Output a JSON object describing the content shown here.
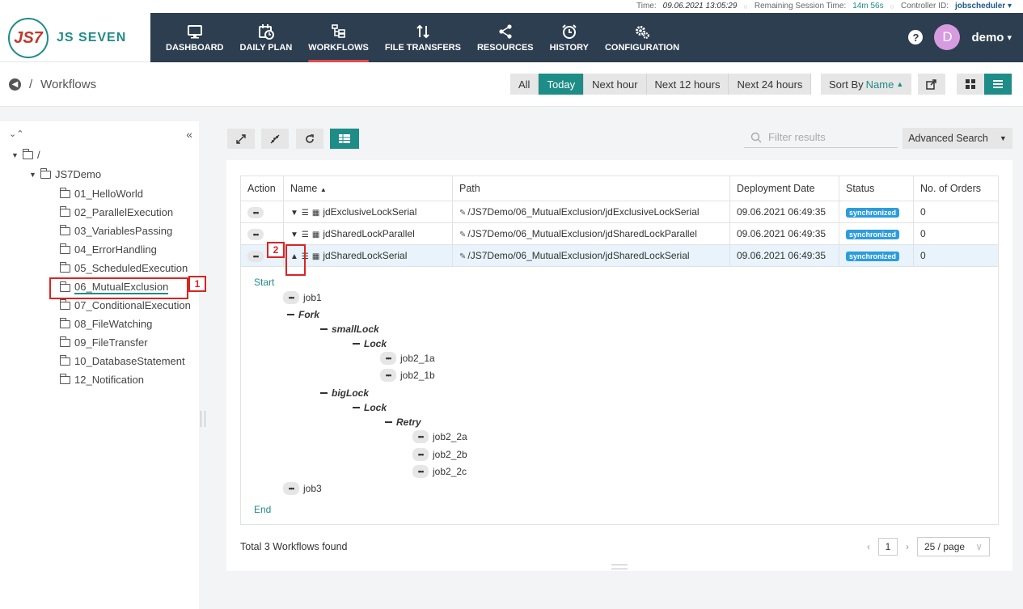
{
  "status_bar": {
    "time_label": "Time:",
    "time_value": "09.06.2021 13:05:29",
    "session_label": "Remaining Session Time:",
    "session_value": "14m 56s",
    "controller_label": "Controller ID:",
    "controller_value": "jobscheduler"
  },
  "brand": {
    "logo_mark": "JS7",
    "logo_text": "JS SEVEN"
  },
  "nav": [
    {
      "label": "DASHBOARD",
      "icon": "monitor-icon"
    },
    {
      "label": "DAILY PLAN",
      "icon": "calendar-icon"
    },
    {
      "label": "WORKFLOWS",
      "icon": "workflow-icon",
      "active": true
    },
    {
      "label": "FILE TRANSFERS",
      "icon": "transfer-icon"
    },
    {
      "label": "RESOURCES",
      "icon": "share-icon"
    },
    {
      "label": "HISTORY",
      "icon": "clock-icon"
    },
    {
      "label": "CONFIGURATION",
      "icon": "gears-icon"
    }
  ],
  "user": {
    "initial": "D",
    "name": "demo"
  },
  "breadcrumb": {
    "separator": "/",
    "title": "Workflows"
  },
  "filters": [
    "All",
    "Today",
    "Next hour",
    "Next 12 hours",
    "Next 24 hours"
  ],
  "active_filter": "Today",
  "sort": {
    "label": "Sort By",
    "value": "Name"
  },
  "tree": {
    "root": "/",
    "folder": "JS7Demo",
    "items": [
      "01_HelloWorld",
      "02_ParallelExecution",
      "03_VariablesPassing",
      "04_ErrorHandling",
      "05_ScheduledExecution",
      "06_MutualExclusion",
      "07_ConditionalExecution",
      "08_FileWatching",
      "09_FileTransfer",
      "10_DatabaseStatement",
      "12_Notification"
    ],
    "selected": "06_MutualExclusion"
  },
  "annotations": {
    "marker1": "1",
    "marker2": "2"
  },
  "search": {
    "placeholder": "Filter results"
  },
  "advanced_search_label": "Advanced Search",
  "table": {
    "headers": [
      "Action",
      "Name",
      "Path",
      "Deployment Date",
      "Status",
      "No. of Orders"
    ],
    "rows": [
      {
        "name": "jdExclusiveLockSerial",
        "path": "/JS7Demo/06_MutualExclusion/jdExclusiveLockSerial",
        "date": "09.06.2021 06:49:35",
        "status": "synchronized",
        "orders": "0"
      },
      {
        "name": "jdSharedLockParallel",
        "path": "/JS7Demo/06_MutualExclusion/jdSharedLockParallel",
        "date": "09.06.2021 06:49:35",
        "status": "synchronized",
        "orders": "0"
      },
      {
        "name": "jdSharedLockSerial",
        "path": "/JS7Demo/06_MutualExclusion/jdSharedLockSerial",
        "date": "09.06.2021 06:49:35",
        "status": "synchronized",
        "orders": "0"
      }
    ]
  },
  "flow": {
    "start": "Start",
    "end": "End",
    "job1": "job1",
    "fork": "Fork",
    "small_lock": "smallLock",
    "lock": "Lock",
    "job2_1a": "job2_1a",
    "job2_1b": "job2_1b",
    "big_lock": "bigLock",
    "retry": "Retry",
    "job2_2a": "job2_2a",
    "job2_2b": "job2_2b",
    "job2_2c": "job2_2c",
    "job3": "job3"
  },
  "footer": {
    "total": "Total 3 Workflows found",
    "page": "1",
    "page_size": "25 / page"
  },
  "colors": {
    "header_bg": "#2c3e50",
    "accent": "#1e8c87",
    "marker": "#dd2222",
    "badge": "#2d9cdb"
  }
}
